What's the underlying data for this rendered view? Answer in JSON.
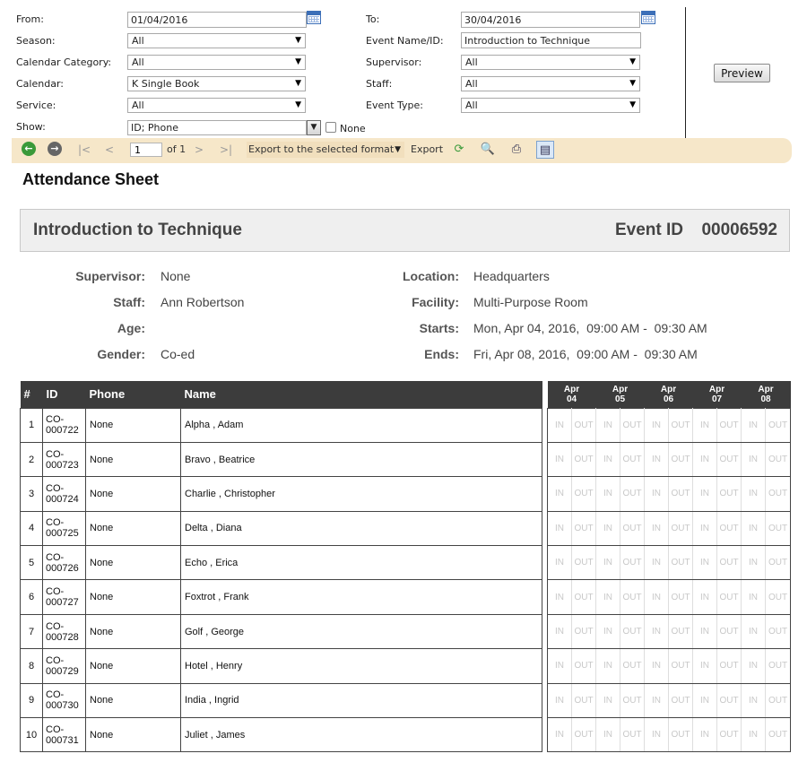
{
  "filters": {
    "from": {
      "label": "From:",
      "value": "01/04/2016"
    },
    "to": {
      "label": "To:",
      "value": "30/04/2016"
    },
    "season": {
      "label": "Season:",
      "value": "All"
    },
    "event_name": {
      "label": "Event Name/ID:",
      "value": "Introduction to Technique"
    },
    "calendar_category": {
      "label": "Calendar Category:",
      "value": "All"
    },
    "supervisor": {
      "label": "Supervisor:",
      "value": "All"
    },
    "calendar": {
      "label": "Calendar:",
      "value": "K Single Book"
    },
    "staff": {
      "label": "Staff:",
      "value": "All"
    },
    "service": {
      "label": "Service:",
      "value": "All"
    },
    "event_type": {
      "label": "Event Type:",
      "value": "All"
    },
    "show": {
      "label": "Show:",
      "value": "ID; Phone",
      "none_label": "None"
    },
    "preview_label": "Preview"
  },
  "toolbar": {
    "page_value": "1",
    "page_of": "of 1",
    "export_format": "Export to the selected format",
    "export_label": "Export",
    "icons": [
      "back-icon",
      "forward-icon",
      "first-page-icon",
      "prev-page-icon",
      "next-page-icon",
      "last-page-icon",
      "refresh-icon",
      "zoom-icon",
      "print-icon",
      "print-layout-icon"
    ]
  },
  "report": {
    "title": "Attendance Sheet",
    "event_name": "Introduction to Technique",
    "event_id_label": "Event ID",
    "event_id": "00006592",
    "details_left": [
      {
        "label": "Supervisor:",
        "value": "None"
      },
      {
        "label": "Staff:",
        "value": "Ann Robertson"
      },
      {
        "label": "Age:",
        "value": ""
      },
      {
        "label": "Gender:",
        "value": "Co-ed"
      }
    ],
    "details_right": [
      {
        "label": "Location:",
        "value": "Headquarters"
      },
      {
        "label": "Facility:",
        "value": "Multi-Purpose Room"
      },
      {
        "label": "Starts:",
        "value": "Mon, Apr 04, 2016,  09:00 AM -  09:30 AM"
      },
      {
        "label": "Ends:",
        "value": "Fri, Apr 08, 2016,  09:00 AM -  09:30 AM"
      }
    ]
  },
  "table": {
    "headers": [
      "#",
      "ID",
      "Phone",
      "Name"
    ],
    "dates": [
      {
        "month": "Apr",
        "day": "04"
      },
      {
        "month": "Apr",
        "day": "05"
      },
      {
        "month": "Apr",
        "day": "06"
      },
      {
        "month": "Apr",
        "day": "07"
      },
      {
        "month": "Apr",
        "day": "08"
      }
    ],
    "in_label": "IN",
    "out_label": "OUT",
    "rows": [
      {
        "num": "1",
        "id_line1": "CO-",
        "id_line2": "000722",
        "phone": "None",
        "name": "Alpha , Adam"
      },
      {
        "num": "2",
        "id_line1": "CO-",
        "id_line2": "000723",
        "phone": "None",
        "name": "Bravo , Beatrice"
      },
      {
        "num": "3",
        "id_line1": "CO-",
        "id_line2": "000724",
        "phone": "None",
        "name": "Charlie , Christopher"
      },
      {
        "num": "4",
        "id_line1": "CO-",
        "id_line2": "000725",
        "phone": "None",
        "name": "Delta , Diana"
      },
      {
        "num": "5",
        "id_line1": "CO-",
        "id_line2": "000726",
        "phone": "None",
        "name": "Echo , Erica"
      },
      {
        "num": "6",
        "id_line1": "CO-",
        "id_line2": "000727",
        "phone": "None",
        "name": "Foxtrot , Frank"
      },
      {
        "num": "7",
        "id_line1": "CO-",
        "id_line2": "000728",
        "phone": "None",
        "name": "Golf , George"
      },
      {
        "num": "8",
        "id_line1": "CO-",
        "id_line2": "000729",
        "phone": "None",
        "name": "Hotel , Henry"
      },
      {
        "num": "9",
        "id_line1": "CO-",
        "id_line2": "000730",
        "phone": "None",
        "name": "India , Ingrid"
      },
      {
        "num": "10",
        "id_line1": "CO-",
        "id_line2": "000731",
        "phone": "None",
        "name": "Juliet , James"
      }
    ]
  }
}
